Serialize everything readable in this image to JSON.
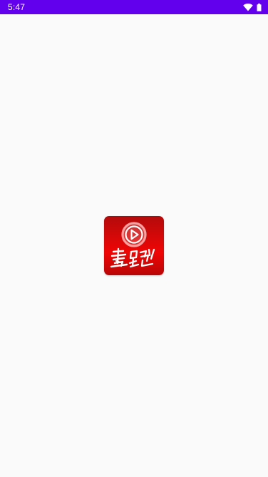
{
  "status_bar": {
    "time": "5:47",
    "background": "#6200ee",
    "icons": [
      "wifi-icon",
      "battery-icon"
    ]
  },
  "splash": {
    "background": "#fafafa",
    "logo": {
      "icon": "play-icon",
      "wordmark": "毒蛇",
      "colors": {
        "base": "#d80808",
        "dark": "#b30a0a",
        "mark": "#ffffff"
      }
    }
  }
}
